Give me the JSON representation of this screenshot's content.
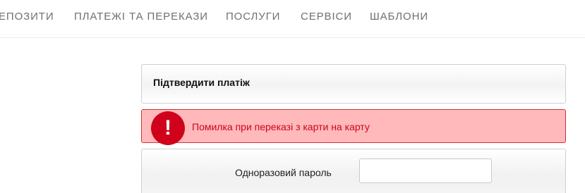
{
  "nav": {
    "items": [
      {
        "label": "ЕПОЗИТИ"
      },
      {
        "label": "ПЛАТЕЖІ ТА ПЕРЕКАЗИ"
      },
      {
        "label": "ПОСЛУГИ"
      },
      {
        "label": "СЕРВІСИ"
      },
      {
        "label": "ШАБЛОНИ"
      }
    ]
  },
  "confirm_panel": {
    "title": "Підтвердити платіж"
  },
  "alert": {
    "icon": "exclamation-icon",
    "icon_glyph": "!",
    "message": "Помилка при переказі з карти на карту",
    "colors": {
      "background": "#ffb9bb",
      "border": "#d2303a",
      "accent": "#d0021b"
    }
  },
  "otp": {
    "label": "Одноразовий пароль",
    "value": ""
  }
}
